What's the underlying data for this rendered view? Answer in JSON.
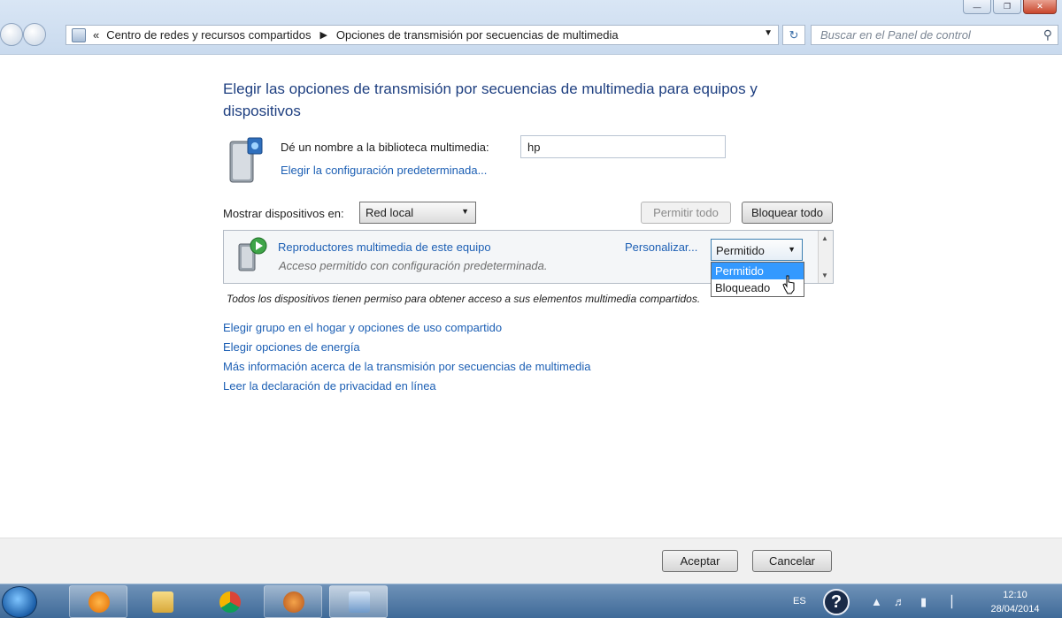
{
  "window": {
    "controls": {
      "minimize": "—",
      "maximize": "❐",
      "close": "✕"
    }
  },
  "address_bar": {
    "prefix": "«",
    "crumbs": [
      "Centro de redes y recursos compartidos",
      "Opciones de transmisión por secuencias de multimedia"
    ],
    "separator": "▶",
    "dropdown": "▼",
    "refresh": "↻"
  },
  "search": {
    "placeholder": "Buscar en el Panel de control",
    "icon": "search-icon"
  },
  "page": {
    "title": "Elegir las opciones de transmisión por secuencias de multimedia para equipos y dispositivos",
    "library_label": "Dé un nombre a la biblioteca multimedia:",
    "library_value": "hp",
    "library_link": "Elegir la configuración predeterminada...",
    "show_devices_label": "Mostrar dispositivos en:",
    "show_devices_value": "Red local",
    "allow_all": "Permitir todo",
    "block_all": "Bloquear todo"
  },
  "device": {
    "name": "Reproductores multimedia de este equipo",
    "description": "Acceso permitido con configuración predeterminada.",
    "customize": "Personalizar...",
    "permission_value": "Permitido",
    "options": [
      "Permitido",
      "Bloqueado"
    ],
    "selected_option": 0
  },
  "note": "Todos los dispositivos tienen permiso para obtener acceso a sus elementos multimedia compartidos.",
  "links": [
    "Elegir grupo en el hogar y opciones de uso compartido",
    "Elegir opciones de energía",
    "Más información acerca de la transmisión por secuencias de multimedia",
    "Leer la declaración de privacidad en línea"
  ],
  "footer": {
    "ok": "Aceptar",
    "cancel": "Cancelar"
  },
  "taskbar": {
    "items": [
      "media-player-icon",
      "explorer-folder-icon",
      "chrome-icon",
      "glove-app-icon",
      "control-panel-icon"
    ],
    "language": "ES",
    "help": "?",
    "time": "12:10",
    "date": "28/04/2014"
  },
  "colors": {
    "link": "#1c5fb4",
    "title": "#1e3f80",
    "selection": "#3399ff"
  }
}
